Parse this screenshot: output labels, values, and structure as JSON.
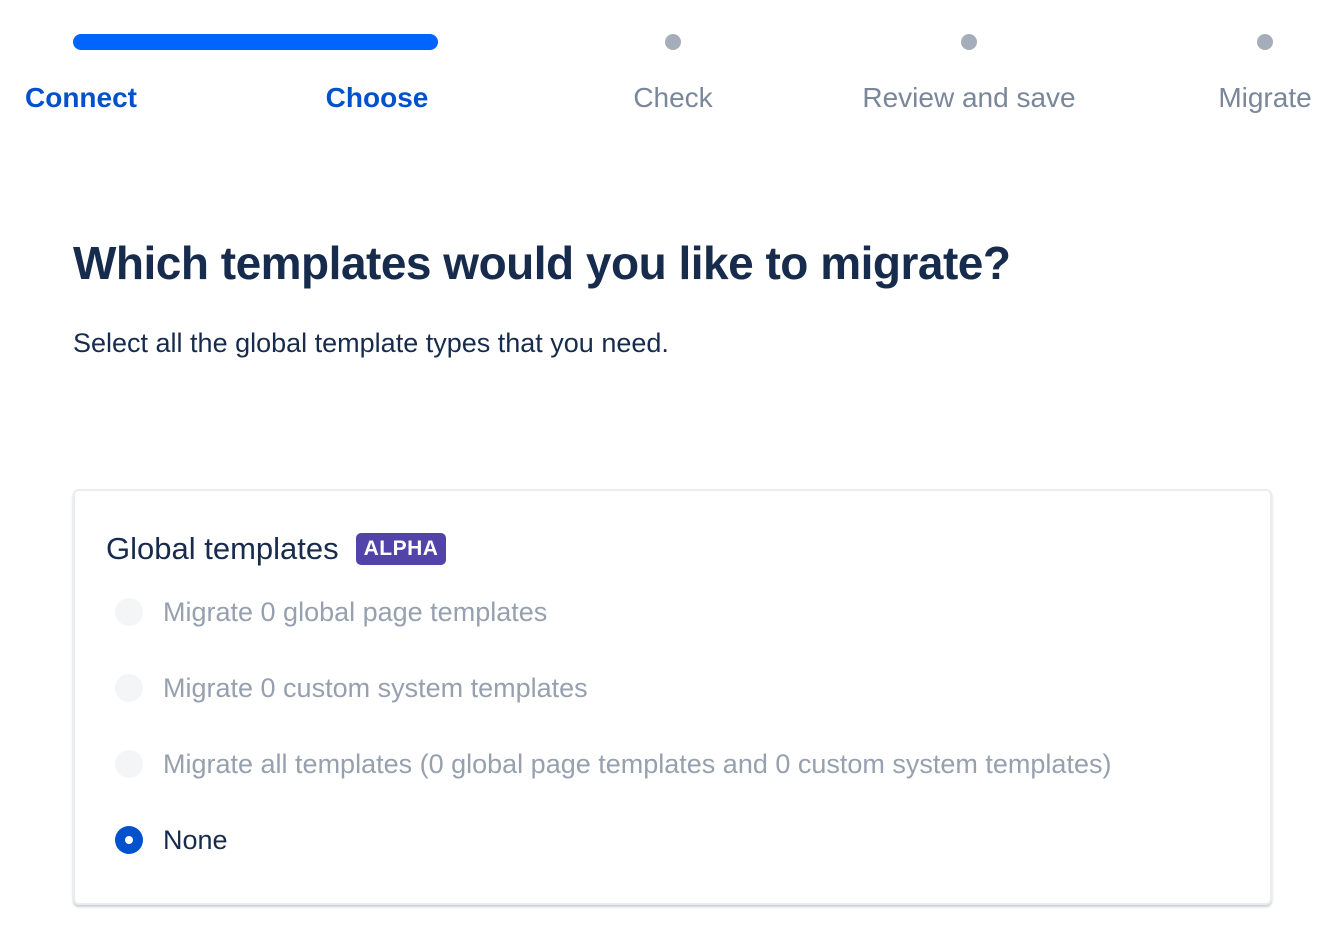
{
  "tracker": {
    "progress_percent": 30,
    "steps": [
      {
        "label": "Connect",
        "state": "completed"
      },
      {
        "label": "Choose",
        "state": "current"
      },
      {
        "label": "Check",
        "state": "upcoming"
      },
      {
        "label": "Review and save",
        "state": "upcoming"
      },
      {
        "label": "Migrate",
        "state": "upcoming"
      }
    ]
  },
  "main": {
    "title": "Which templates would you like to migrate?",
    "subtitle": "Select all the global template types that you need."
  },
  "card": {
    "title": "Global templates",
    "badge": "ALPHA",
    "options": [
      {
        "label": "Migrate 0 global page templates",
        "disabled": true,
        "selected": false
      },
      {
        "label": "Migrate 0 custom system templates",
        "disabled": true,
        "selected": false
      },
      {
        "label": "Migrate all templates (0 global page templates and 0 custom system templates)",
        "disabled": true,
        "selected": false
      },
      {
        "label": "None",
        "disabled": false,
        "selected": true
      }
    ]
  },
  "colors": {
    "accent": "#0052cc",
    "progress": "#0065ff",
    "badge": "#5243aa",
    "text": "#172b4d",
    "muted": "#7a869a",
    "disabled_text": "#97a0af"
  }
}
